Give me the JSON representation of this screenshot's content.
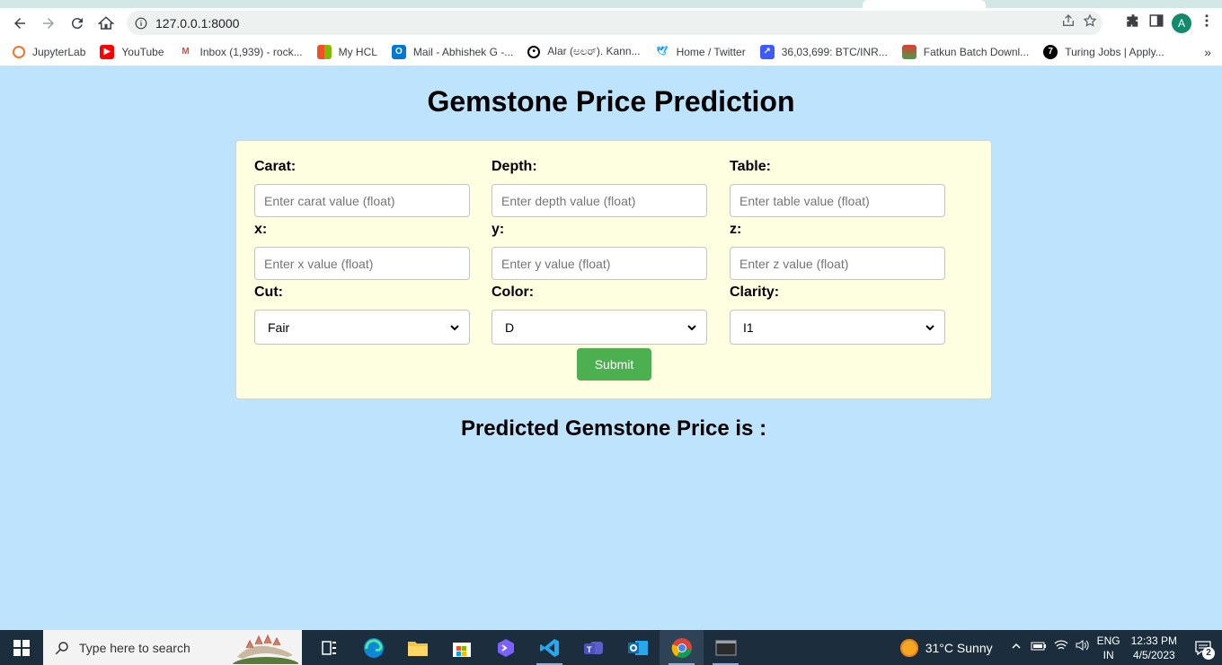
{
  "browser": {
    "url": "127.0.0.1:8000",
    "bookmarks": [
      {
        "label": "JupyterLab",
        "icon": "jupyter-icon",
        "color": "#f37626"
      },
      {
        "label": "YouTube",
        "icon": "youtube-icon",
        "color": "#ff0000"
      },
      {
        "label": "Inbox (1,939) - rock...",
        "icon": "gmail-icon",
        "color": "#ea4335"
      },
      {
        "label": "My HCL",
        "icon": "windows-squares-icon",
        "color": "#f25022"
      },
      {
        "label": "Mail - Abhishek G -...",
        "icon": "outlook-icon",
        "color": "#0078d4"
      },
      {
        "label": "Alar (ಅಲರ್). Kann...",
        "icon": "alar-icon",
        "color": "#000000"
      },
      {
        "label": "Home / Twitter",
        "icon": "twitter-icon",
        "color": "#1d9bf0"
      },
      {
        "label": "36,03,699: BTC/INR...",
        "icon": "chart-icon",
        "color": "#3d5afe"
      },
      {
        "label": "Fatkun Batch Downl...",
        "icon": "fatkun-icon",
        "color": "#e53935"
      },
      {
        "label": "Turing Jobs | Apply...",
        "icon": "turing-icon",
        "color": "#000000"
      }
    ],
    "avatar_letter": "A"
  },
  "page": {
    "title": "Gemstone Price Prediction",
    "fields": {
      "carat": {
        "label": "Carat:",
        "placeholder": "Enter carat value (float)"
      },
      "depth": {
        "label": "Depth:",
        "placeholder": "Enter depth value (float)"
      },
      "table": {
        "label": "Table:",
        "placeholder": "Enter table value (float)"
      },
      "x": {
        "label": "x:",
        "placeholder": "Enter x value (float)"
      },
      "y": {
        "label": "y:",
        "placeholder": "Enter y value (float)"
      },
      "z": {
        "label": "z:",
        "placeholder": "Enter z value (float)"
      },
      "cut": {
        "label": "Cut:",
        "value": "Fair"
      },
      "color": {
        "label": "Color:",
        "value": "D"
      },
      "clarity": {
        "label": "Clarity:",
        "value": "I1"
      }
    },
    "submit_label": "Submit",
    "result_text": "Predicted Gemstone Price is :"
  },
  "taskbar": {
    "search_placeholder": "Type here to search",
    "weather": "31°C  Sunny",
    "lang_line1": "ENG",
    "lang_line2": "IN",
    "time": "12:33 PM",
    "date": "4/5/2023",
    "notification_count": "2"
  }
}
